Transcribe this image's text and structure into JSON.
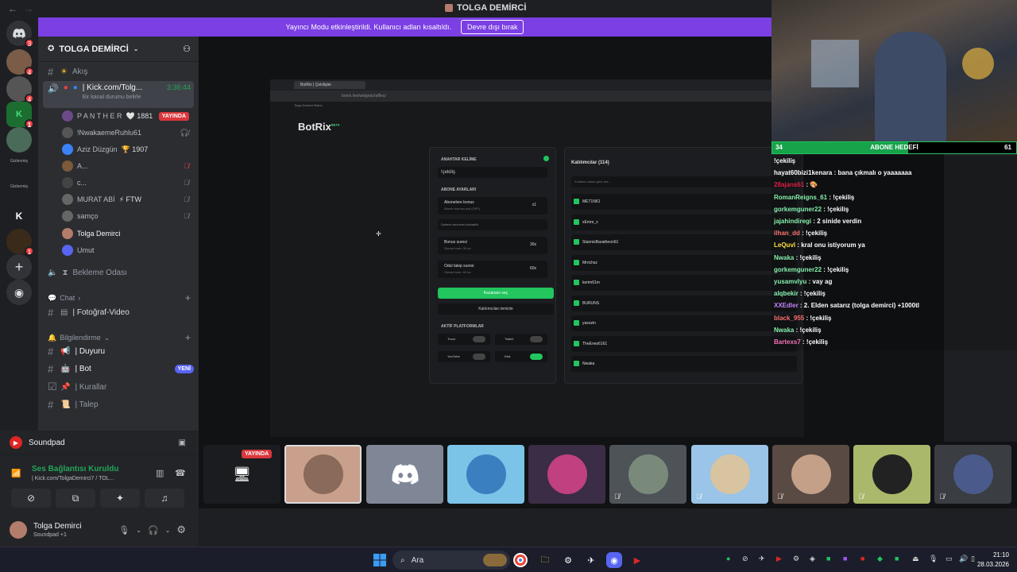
{
  "window": {
    "title": "TOLGA DEMİRCİ"
  },
  "banner": {
    "text": "Yayıncı Modu etkinleştirildi. Kullanıcı adları kısaltıldı.",
    "button": "Devre dışı bırak"
  },
  "guilds": [
    {
      "badge": "3",
      "color": "#5865f2",
      "icon": "discord-home-icon"
    },
    {
      "badge": "4",
      "color": "#7a5c48",
      "icon": "server-avatar-icon"
    },
    {
      "badge": "4",
      "color": "#555",
      "icon": "server-avatar-icon"
    },
    {
      "badge": "1",
      "color": "#1b6e2f",
      "icon": "server-avatar-icon"
    },
    {
      "badge": "",
      "color": "#4a6a5a",
      "icon": "server-avatar-icon"
    },
    {
      "label": "Gizlenmiş",
      "color": "#2b2d31"
    },
    {
      "label": "Gizlenmiş",
      "color": "#2b2d31"
    },
    {
      "text": "K",
      "color": "#2b2d31"
    },
    {
      "badge": "1",
      "color": "#3a2a1a",
      "icon": "server-avatar-icon"
    }
  ],
  "server": {
    "name": "TOLGA DEMİRCİ"
  },
  "channels": {
    "akis": "Akış",
    "voice_active": {
      "name": "| Kick.com/Tolg...",
      "timer": "3:36:44",
      "status": "Bir kanal durumu belirle"
    },
    "users": [
      {
        "name": "P A N T H E R",
        "extra": "🤍 1881",
        "live": "YAYINDA",
        "color": "#6b4a8a"
      },
      {
        "name": "!NwakaemeRuhlu61",
        "extra": "",
        "color": "#555"
      },
      {
        "name": "Aziz Düzgün",
        "extra": "🏆 1907",
        "color": "#3b82f6"
      },
      {
        "name": "A...",
        "extra": "",
        "color": "#7c5a3a",
        "red": true
      },
      {
        "name": "c...",
        "extra": "",
        "color": "#444"
      },
      {
        "name": "MURAT ABİ",
        "extra": "⚡ FTW",
        "color": "#666"
      },
      {
        "name": "samço",
        "extra": "",
        "color": "#666"
      },
      {
        "name": "Tolga Demirci",
        "extra": "",
        "color": "#b47c6a",
        "highlight": true
      },
      {
        "name": "Umut",
        "extra": "",
        "color": "#5865f2"
      }
    ],
    "bekleme": "Bekleme Odası",
    "cat_chat": "Chat",
    "fotograf": "| Fotoğraf-Video",
    "cat_bilgi": "Bilgilendirme",
    "duyuru": "| Duyuru",
    "bot": "| Bot",
    "bot_badge": "YENİ",
    "kurallar": "| Kurallar",
    "talep": "| Talep"
  },
  "soundpad": {
    "name": "Soundpad"
  },
  "voice_panel": {
    "status": "Ses Bağlantısı Kuruldu",
    "channel": "| Kick.com/TolgaDemirci7 / TOL..."
  },
  "user": {
    "name": "Tolga Demirci",
    "sub": "Soundpad +1"
  },
  "stream": {
    "tab": "BotRix | Çekilişler",
    "url": "botrix.live/widgets/raffles/",
    "bookmarks": "Tolga Demirci    Botrix",
    "logo": "BotRix",
    "logo_sup": "BETA",
    "left": {
      "keyword_label": "ANAHTAR KELİME",
      "keyword_value": "!çekiliş",
      "subs_label": "ABONE AYARLARI",
      "bonus_title": "Abonelere bonus",
      "bonus_sub": "Abone bonusu yok (OFF)",
      "bonus_val": "x1",
      "only_subs": "Sadece aboneler katılabilir",
      "duration_title": "Bonus suresi",
      "duration_sub": "Guncel sure: 30 sn",
      "duration_val": "30s",
      "claim_title": "Odul talep suresi",
      "claim_sub": "Guncel sure: 60 sn",
      "claim_val": "60s",
      "pick_btn": "Kazananı seç",
      "clear_btn": "Katılımcıları temizle",
      "platforms_label": "AKTİF PLATFORMLAR",
      "platforms": [
        {
          "name": "Trovo",
          "on": false
        },
        {
          "name": "Twitch",
          "on": false
        },
        {
          "name": "YouTube",
          "on": false
        },
        {
          "name": "Kick",
          "on": true
        }
      ]
    },
    "right": {
      "title": "Katılımcılar (114)",
      "search": "Kullanıcı adına göre ara...",
      "participants": [
        "MET1N61",
        "xEmre_x",
        "StannisBaratheon61",
        "Mrrichsz",
        "kerim61m",
        "BURUNS",
        "yasozin",
        "TheEnes6161",
        "Nwaka"
      ]
    }
  },
  "goal": {
    "current": "34",
    "label": "ABONE HEDEFİ",
    "target": "61",
    "progress": 0.557
  },
  "chat": [
    {
      "user": "",
      "msg": "!çekiliş",
      "color": "#fff"
    },
    {
      "user": "hayat60bizi1kenara",
      "msg": " : bana çıkmalı o yaaaaaaa",
      "color": "#fff"
    },
    {
      "user": "28ajans61",
      "msg": " : 🎨",
      "color": "#e11d48"
    },
    {
      "user": "RomanReigns_61",
      "msg": " : !çekiliş",
      "color": "#86efac"
    },
    {
      "user": "gorkemguner22",
      "msg": " : !çekiliş",
      "color": "#86efac"
    },
    {
      "user": "jajahindiregi",
      "msg": " : 2 sinide verdin",
      "color": "#86efac"
    },
    {
      "user": "ilhan_dd",
      "msg": " : !çekiliş",
      "color": "#f87171"
    },
    {
      "user": "LeQuvl",
      "msg": " : kral onu istiyorum ya",
      "color": "#fde047"
    },
    {
      "user": "Nwaka",
      "msg": " : !çekiliş",
      "color": "#86efac"
    },
    {
      "user": "gorkemguner22",
      "msg": " : !çekiliş",
      "color": "#86efac"
    },
    {
      "user": "yusamvlyu",
      "msg": " : vay ag",
      "color": "#86efac"
    },
    {
      "user": "alqbekir",
      "msg": " : !çekiliş",
      "color": "#86efac"
    },
    {
      "user": "XXEdler",
      "msg": " : 2. Elden satarız (tolga demirci) +1000tl",
      "color": "#c084fc"
    },
    {
      "user": "black_955",
      "msg": " : !çekiliş",
      "color": "#f87171"
    },
    {
      "user": "Nwaka",
      "msg": " : !çekiliş",
      "color": "#86efac"
    },
    {
      "user": "Bartexs7",
      "msg": " : !çekiliş",
      "color": "#f472b6"
    }
  ],
  "tiles": {
    "live": "YAYINDA"
  },
  "taskbar": {
    "search": "Ara",
    "time": "21:10",
    "date": "28.03.2026"
  }
}
